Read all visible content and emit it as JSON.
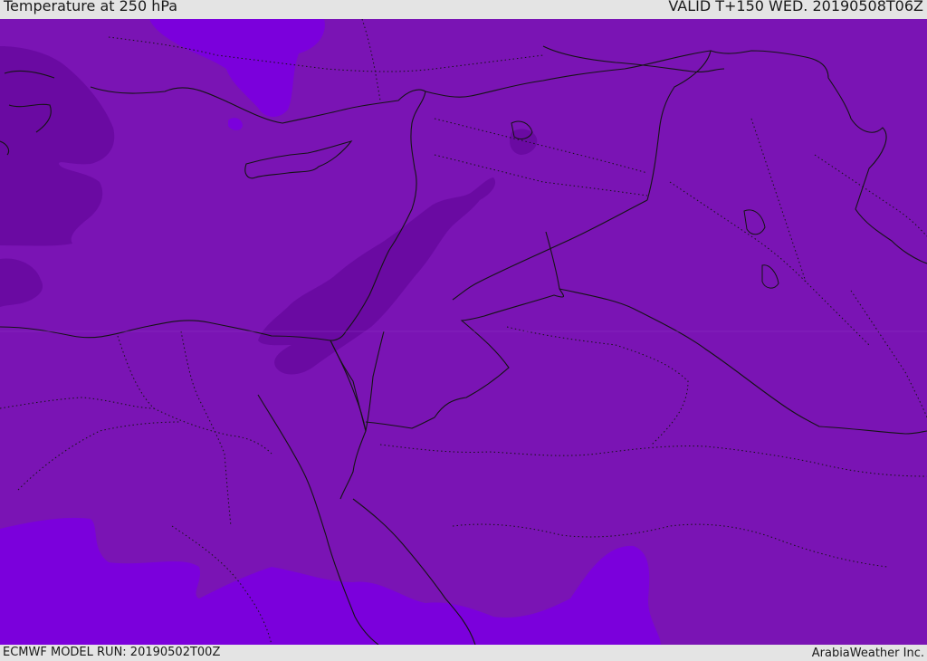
{
  "header": {
    "title": "Temperature at 250 hPa",
    "valid": "VALID T+150 WED. 20190508T06Z"
  },
  "footer": {
    "model_run": "ECMWF MODEL RUN: 20190502T00Z",
    "credit": "ArabiaWeather Inc."
  },
  "map": {
    "colors": {
      "base": "#7a14b4",
      "cold": "#6a0aa2",
      "warm": "#7b00dc",
      "border": "#141414"
    }
  }
}
